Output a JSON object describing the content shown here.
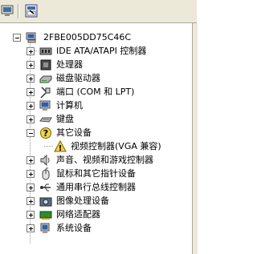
{
  "toolbar": {
    "buttons": [
      {
        "icon": "display-device-icon"
      },
      {
        "icon": "properties-icon"
      }
    ]
  },
  "tree": {
    "root": {
      "label": "2FBE005DD75C46C",
      "icon": "computer-icon"
    },
    "items": [
      {
        "label": "IDE ATA/ATAPI 控制器",
        "icon": "ide-controller-icon",
        "expanded": false
      },
      {
        "label": "处理器",
        "icon": "processor-icon",
        "expanded": false
      },
      {
        "label": "磁盘驱动器",
        "icon": "disk-drive-icon",
        "expanded": false
      },
      {
        "label": "端口 (COM 和 LPT)",
        "icon": "port-icon",
        "expanded": false
      },
      {
        "label": "计算机",
        "icon": "computer-icon",
        "expanded": false
      },
      {
        "label": "键盘",
        "icon": "keyboard-icon",
        "expanded": false
      },
      {
        "label": "其它设备",
        "icon": "unknown-device-icon",
        "expanded": true,
        "children": [
          {
            "label": "视频控制器(VGA 兼容)",
            "icon": "warning-device-icon"
          }
        ]
      },
      {
        "label": "声音、视频和游戏控制器",
        "icon": "sound-icon",
        "expanded": false
      },
      {
        "label": "鼠标和其它指针设备",
        "icon": "mouse-icon",
        "expanded": false
      },
      {
        "label": "通用串行总线控制器",
        "icon": "usb-icon",
        "expanded": false
      },
      {
        "label": "图像处理设备",
        "icon": "imaging-device-icon",
        "expanded": false
      },
      {
        "label": "网络适配器",
        "icon": "network-adapter-icon",
        "expanded": false
      },
      {
        "label": "系统设备",
        "icon": "system-device-icon",
        "expanded": false
      }
    ]
  }
}
